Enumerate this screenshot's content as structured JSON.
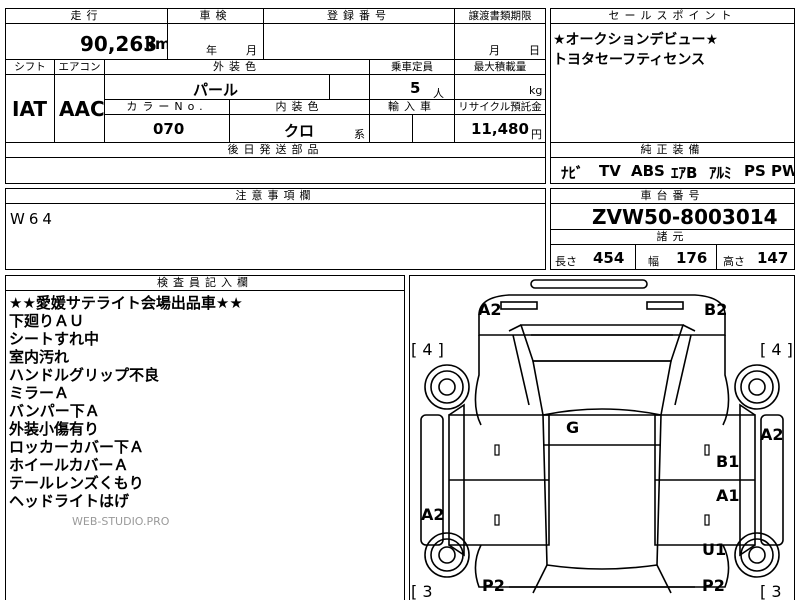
{
  "top_table": {
    "mileage_label": "走行",
    "mileage_value": "90,263",
    "mileage_unit": "km",
    "inspection_label": "車検",
    "inspection_year_unit": "年",
    "inspection_month_unit": "月",
    "registration_label": "登録番号",
    "transfer_label": "譲渡書類期限",
    "transfer_month_unit": "月",
    "transfer_day_unit": "日",
    "shift_label": "シフト",
    "shift_value": "IAT",
    "ac_label": "エアコン",
    "ac_value": "AAC",
    "exterior_label": "外装色",
    "exterior_value": "パール",
    "capacity_label": "乗車定員",
    "capacity_value": "5",
    "capacity_unit": "人",
    "max_load_label": "最大積載量",
    "max_load_unit": "kg",
    "color_no_label": "カラーNo.",
    "color_no_value": "070",
    "interior_label": "内装色",
    "interior_value": "クロ",
    "interior_unit": "系",
    "import_label": "輸入車",
    "recycle_label": "リサイクル預託金",
    "recycle_value": "11,480",
    "recycle_unit": "円",
    "later_parts_label": "後日発送部品"
  },
  "sales_points": {
    "header": "セールスポイント",
    "lines": [
      "★オークションデビュー★",
      "トヨタセーフティセンス"
    ]
  },
  "standard_equipment": {
    "header": "純正装備",
    "items": [
      "ﾅﾋﾞ",
      "TV",
      "ABS",
      "ｴｱB",
      "ｱﾙﾐ",
      "PS",
      "PW"
    ]
  },
  "notes": {
    "header": "注意事項欄",
    "text": "W64"
  },
  "chassis": {
    "header": "車台番号",
    "value": "ZVW50-8003014",
    "spec_header": "諸元",
    "length_label": "長さ",
    "length_value": "454",
    "width_label": "幅",
    "width_value": "176",
    "height_label": "高さ",
    "height_value": "147"
  },
  "inspector": {
    "header": "検査員記入欄",
    "lines": [
      "★★愛媛サテライト会場出品車★★",
      "下廻りＡＵ",
      "シートすれ中",
      "室内汚れ",
      "ハンドルグリップ不良",
      "ミラーＡ",
      "バンパー下Ａ",
      "外装小傷有り",
      "ロッカーカバー下Ａ",
      "ホイールカバーＡ",
      "テールレンズくもり",
      "ヘッドライトはげ"
    ],
    "watermark": "WEB-STUDIO.PRO"
  },
  "diagram": {
    "marks": {
      "front_left": "A2",
      "front_right": "B2",
      "left_tire_front": "[ 4 ]",
      "right_tire_front": "[ 4 ]",
      "roof": "G",
      "right_fender": "A2",
      "right_front_door": "B1",
      "right_rear_door": "A1",
      "left_rocker": "A2",
      "right_rocker": "U1",
      "left_rear": "P2",
      "right_rear": "P2",
      "left_tire_rear": "[ 3",
      "right_tire_rear": "[ 3"
    }
  }
}
